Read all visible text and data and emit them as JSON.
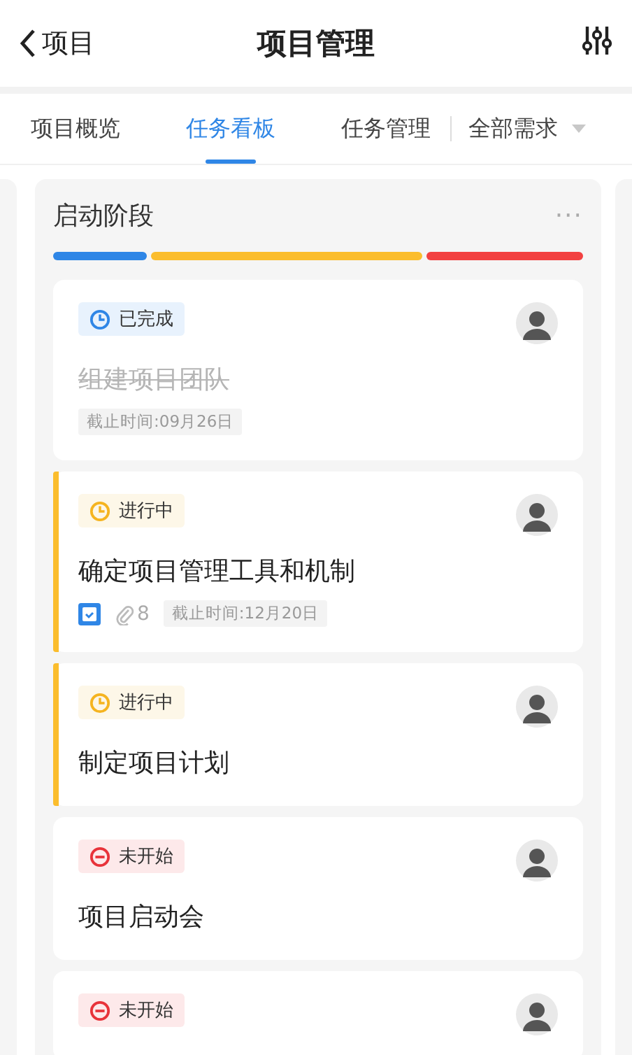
{
  "header": {
    "back_label": "项目",
    "title": "项目管理"
  },
  "tabs": [
    {
      "label": "项目概览",
      "selected": false
    },
    {
      "label": "任务看板",
      "selected": true
    },
    {
      "label": "任务管理",
      "selected": false
    }
  ],
  "filter_dropdown": {
    "label": "全部需求"
  },
  "column": {
    "title": "启动阶段",
    "more": "···",
    "progress": [
      {
        "color": "#2f86e6"
      },
      {
        "color": "#fbbd2d"
      },
      {
        "color": "#f24141"
      }
    ],
    "cards": [
      {
        "kind": "done",
        "status_label": "已完成",
        "title": "组建项目团队",
        "deadline": "截止时间:09月26日"
      },
      {
        "kind": "in_progress",
        "status_label": "进行中",
        "title": "确定项目管理工具和机制",
        "has_checklist": true,
        "attachments": "8",
        "deadline": "截止时间:12月20日"
      },
      {
        "kind": "in_progress",
        "status_label": "进行中",
        "title": "制定项目计划"
      },
      {
        "kind": "not_started",
        "status_label": "未开始",
        "title": "项目启动会"
      },
      {
        "kind": "not_started",
        "status_label": "未开始"
      }
    ]
  }
}
